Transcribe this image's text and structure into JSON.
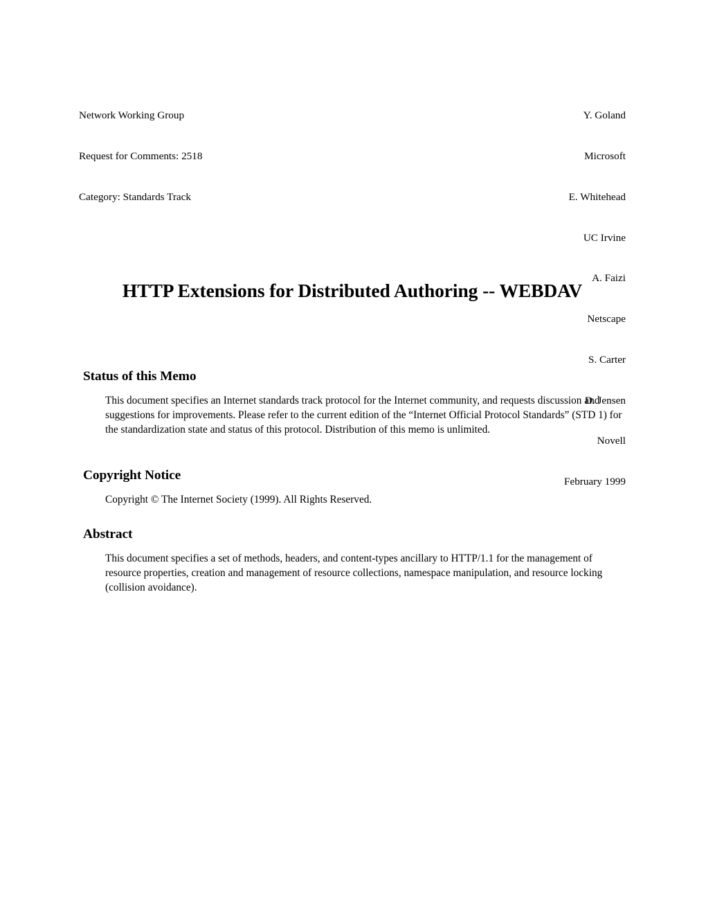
{
  "document": {
    "header": {
      "left_lines": [
        "Network Working Group",
        "Request for Comments: 2518",
        "Category: Standards Track"
      ],
      "right_lines": [
        "Y. Goland",
        "Microsoft",
        "E. Whitehead",
        "UC Irvine",
        "A. Faizi",
        "Netscape",
        "S. Carter",
        "D. Jensen",
        "Novell",
        "February 1999"
      ]
    },
    "title": "HTTP Extensions for Distributed Authoring -- WEBDAV",
    "sections": [
      {
        "id": "status",
        "heading": "Status of this Memo",
        "body": "This document specifies an Internet standards track protocol for the Internet community, and requests discussion and suggestions for improvements. Please refer to the current edition of the “Internet Official Protocol Standards” (STD 1) for the standardization state and status of this protocol. Distribution of this memo is unlimited."
      },
      {
        "id": "copyright",
        "heading": "Copyright Notice",
        "body": "Copyright © The Internet Society (1999). All Rights Reserved."
      },
      {
        "id": "abstract",
        "heading": "Abstract",
        "body": "This document specifies a set of methods, headers, and content-types ancillary to HTTP/1.1 for the management of resource properties, creation and management of resource collections, namespace manipulation, and resource locking (collision avoidance)."
      }
    ]
  }
}
